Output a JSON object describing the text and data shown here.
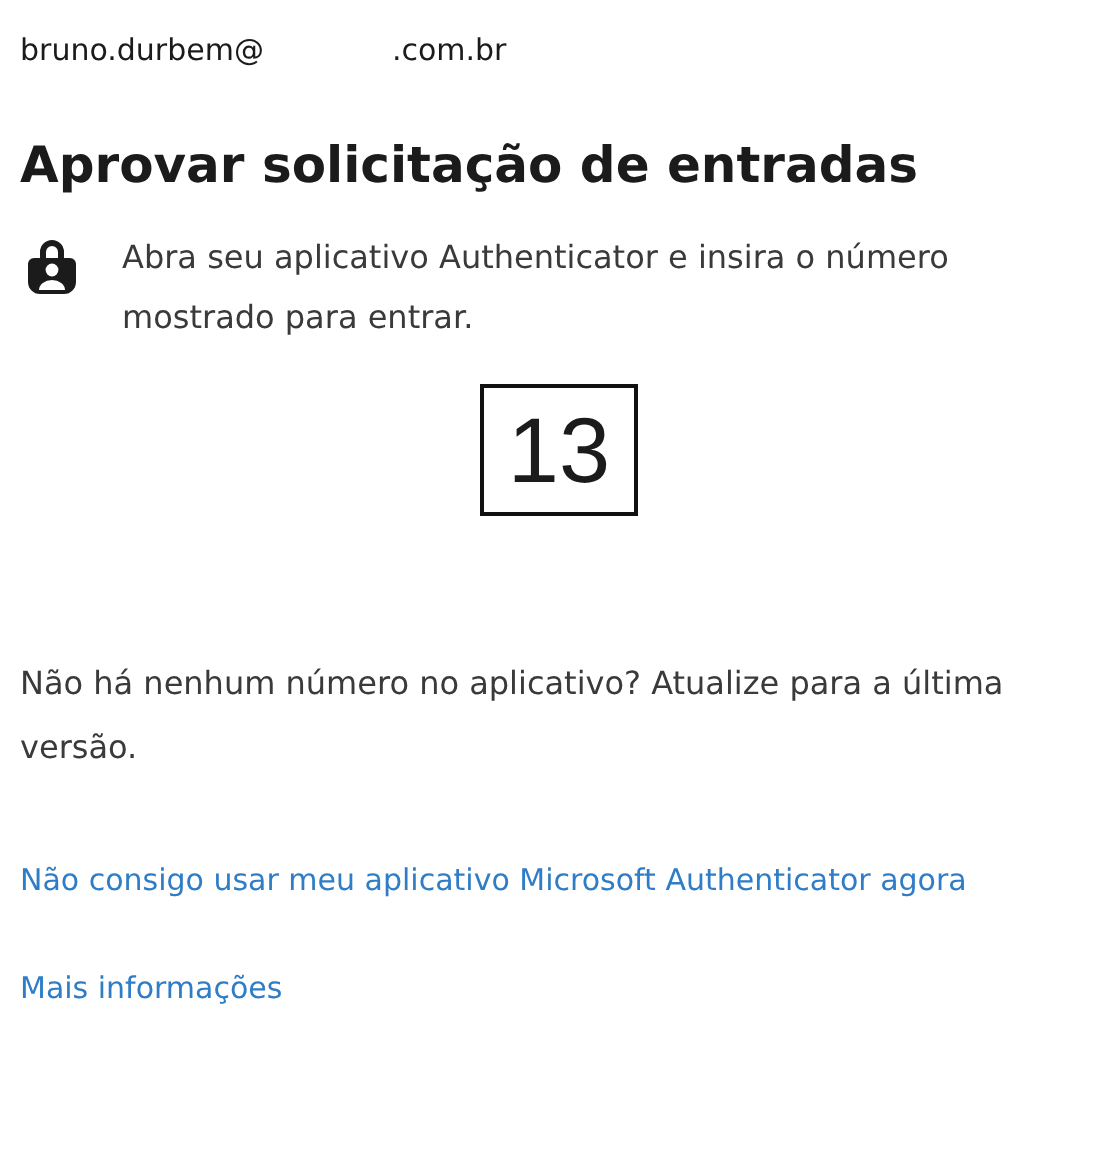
{
  "account": {
    "email_start": "bruno.durbem@",
    "email_end": ".com.br"
  },
  "title": "Aprovar solicitação de entradas",
  "instruction": "Abra seu aplicativo Authenticator e insira o número mostrado para entrar.",
  "number": "13",
  "hint": "Não há nenhum número no aplicativo? Atualize para a última versão.",
  "links": [
    "Não consigo usar meu aplicativo Microsoft Authenticator agora",
    "Mais informações"
  ]
}
